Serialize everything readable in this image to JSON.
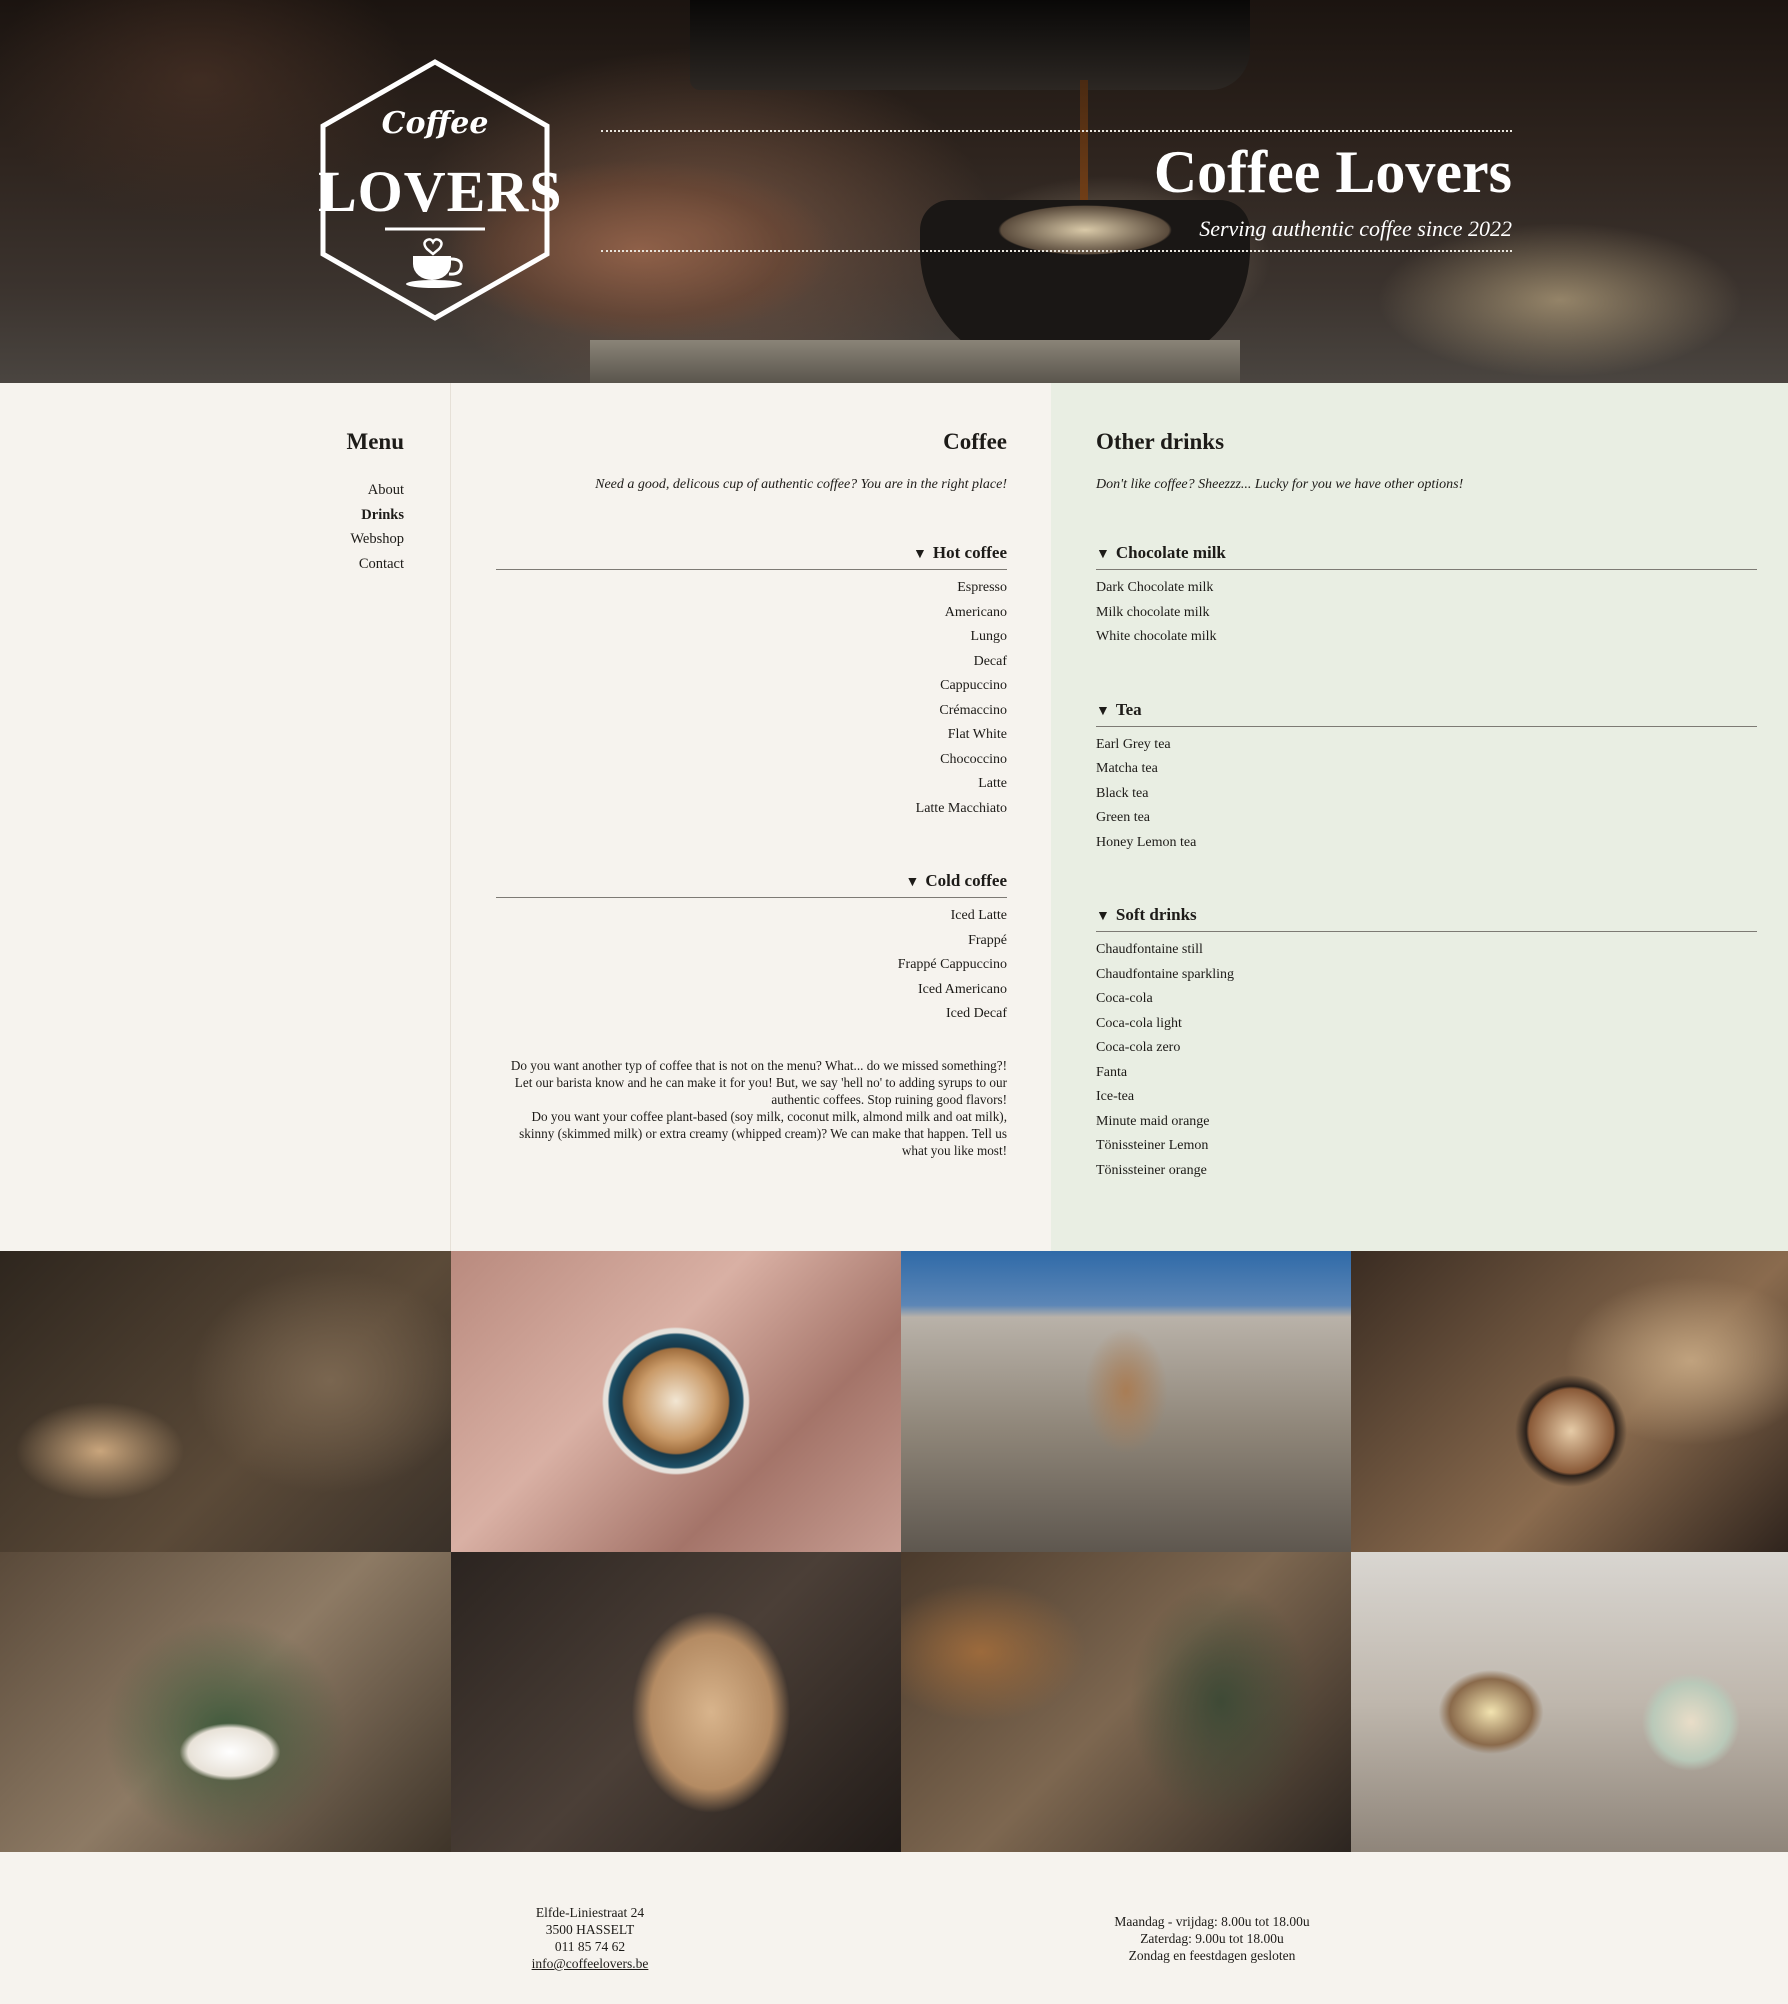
{
  "header": {
    "logo_top": "Coffee",
    "logo_main": "LOVERS",
    "title": "Coffee Lovers",
    "subtitle": "Serving authentic coffee since 2022"
  },
  "menu": {
    "title": "Menu",
    "items": [
      {
        "label": "About"
      },
      {
        "label": "Drinks"
      },
      {
        "label": "Webshop"
      },
      {
        "label": "Contact"
      }
    ]
  },
  "coffee": {
    "title": "Coffee",
    "intro": "Need a good, delicous cup of authentic coffee? You are in the right place!",
    "groups": [
      {
        "title": "Hot coffee",
        "items": [
          "Espresso",
          "Americano",
          "Lungo",
          "Decaf",
          "Cappuccino",
          "Crémaccino",
          "Flat White",
          "Chococcino",
          "Latte",
          "Latte Macchiato"
        ]
      },
      {
        "title": "Cold coffee",
        "items": [
          "Iced Latte",
          "Frappé",
          "Frappé Cappuccino",
          "Iced Americano",
          "Iced Decaf"
        ]
      }
    ],
    "note_1": "Do you want another typ of coffee that is not on the menu? What... do we missed something?! Let our barista know and he can make it for you! But, we say 'hell no' to adding syrups to our authentic coffees. Stop ruining good flavors!",
    "note_2": "Do you want your coffee plant-based (soy milk, coconut milk, almond milk and oat milk), skinny (skimmed milk) or extra creamy (whipped cream)? We can make that happen. Tell us what you like most!"
  },
  "other": {
    "title": "Other drinks",
    "intro": "Don't like coffee? Sheezzz... Lucky for you we have other options!",
    "groups": [
      {
        "title": "Chocolate milk",
        "items": [
          "Dark Chocolate milk",
          "Milk chocolate milk",
          "White chocolate milk"
        ]
      },
      {
        "title": "Tea",
        "items": [
          "Earl Grey tea",
          "Matcha tea",
          "Black tea",
          "Green tea",
          "Honey Lemon tea"
        ]
      },
      {
        "title": "Soft drinks",
        "items": [
          "Chaudfontaine still",
          "Chaudfontaine sparkling",
          "Coca-cola",
          "Coca-cola light",
          "Coca-cola zero",
          "Fanta",
          "Ice-tea",
          "Minute maid orange",
          "Tönissteiner Lemon",
          "Tönissteiner orange"
        ]
      }
    ],
    "caret": "▼"
  },
  "footer": {
    "street": "Elfde-Liniestraat 24",
    "city": "3500 HASSELT",
    "phone": "011 85 74 62",
    "email": "info@coffeelovers.be",
    "hours_1": "Maandag - vrijdag: 8.00u tot 18.00u",
    "hours_2": "Zaterdag: 9.00u tot 18.00u",
    "hours_3": "Zondag en feestdagen gesloten"
  },
  "colors": {
    "page_bg": "#f6f3ee",
    "other_bg": "#e9eee3",
    "text": "#1d1b18"
  }
}
